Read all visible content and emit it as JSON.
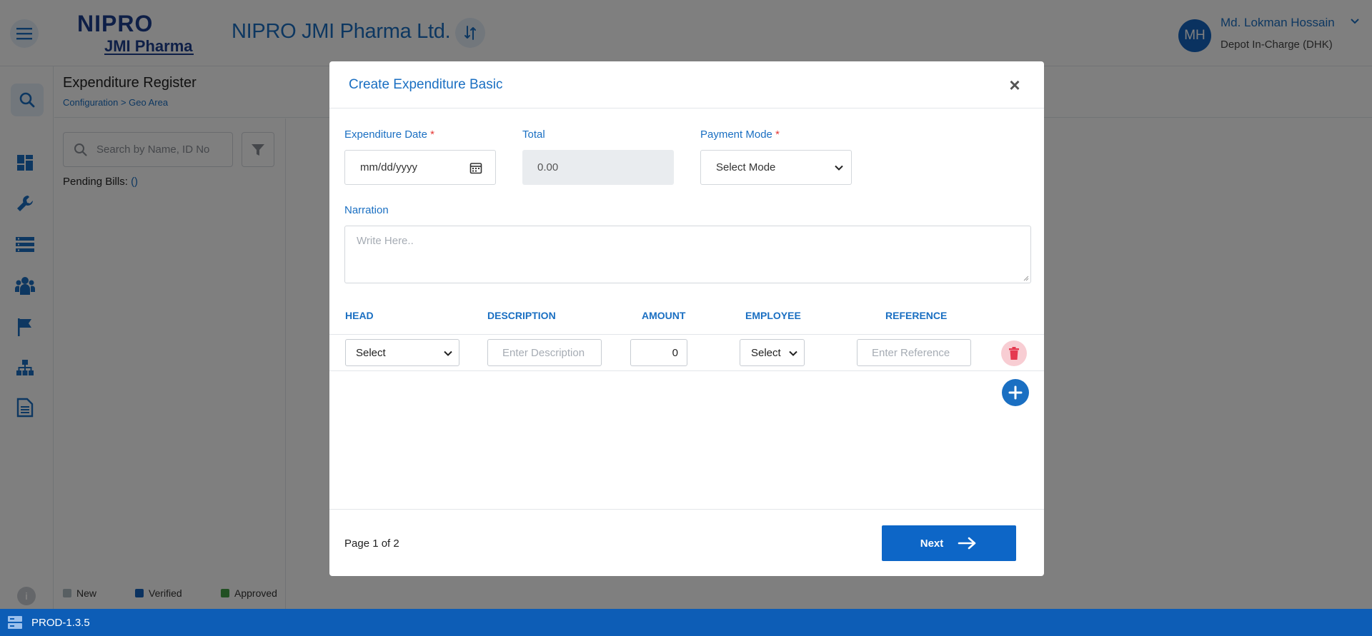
{
  "header": {
    "logo_top": "NIPRO",
    "logo_bottom": "JMI Pharma",
    "brand": "NIPRO JMI Pharma Ltd.",
    "user": {
      "initials": "MH",
      "name": "Md. Lokman Hossain",
      "role": "Depot In-Charge (DHK)"
    }
  },
  "page": {
    "title": "Expenditure Register",
    "breadcrumb": "Configuration > Geo Area",
    "search_placeholder": "Search by Name, ID No",
    "pending_label": "Pending Bills:",
    "pending_count": "()"
  },
  "legend": [
    {
      "label": "New",
      "color": "#b0bec5"
    },
    {
      "label": "Verified",
      "color": "#1565c0"
    },
    {
      "label": "Approved",
      "color": "#43a047"
    }
  ],
  "footer": {
    "version": "PROD-1.3.5"
  },
  "modal": {
    "title": "Create Expenditure Basic",
    "fields": {
      "date_label": "Expenditure Date",
      "date_placeholder": "mm/dd/yyyy",
      "total_label": "Total",
      "total_value": "0.00",
      "mode_label": "Payment Mode",
      "mode_value": "Select Mode",
      "required_mark": "*",
      "narration_label": "Narration",
      "narration_placeholder": "Write Here.."
    },
    "table": {
      "headers": [
        "HEAD",
        "DESCRIPTION",
        "AMOUNT",
        "EMPLOYEE",
        "REFERENCE"
      ],
      "row": {
        "head": "Select",
        "description_placeholder": "Enter Description",
        "amount": "0",
        "employee": "Select",
        "reference_placeholder": "Enter Reference"
      }
    },
    "footer": {
      "page_info": "Page 1 of 2",
      "next_label": "Next"
    }
  },
  "colors": {
    "accent": "#1a6fc2",
    "footer_bar": "#0d5db6",
    "danger": "#e53950"
  },
  "icons": [
    "hamburger-icon",
    "swap-icon",
    "search-icon",
    "dashboard-icon",
    "wrench-icon",
    "list-icon",
    "people-icon",
    "flag-icon",
    "hierarchy-icon",
    "document-icon",
    "info-icon",
    "filter-icon",
    "calendar-icon",
    "chevron-down-icon",
    "trash-icon",
    "plus-icon",
    "arrow-right-icon",
    "close-icon",
    "server-icon"
  ]
}
